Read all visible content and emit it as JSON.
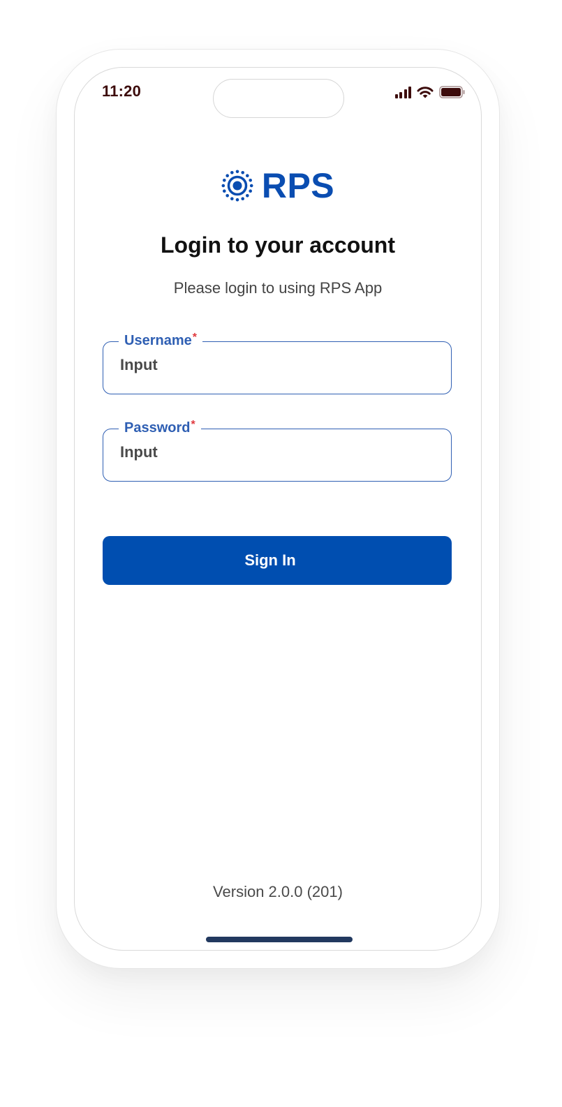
{
  "status_bar": {
    "time": "11:20",
    "signal_icon": "cellular-signal-icon",
    "wifi_icon": "wifi-icon",
    "battery_icon": "battery-icon"
  },
  "brand": {
    "logo_icon": "sun-dots-icon",
    "name": "RPS",
    "color": "#0a4db1"
  },
  "login": {
    "title": "Login to your account",
    "subtitle": "Please login to using RPS App",
    "username": {
      "label": "Username",
      "required_mark": "*",
      "value": "Input"
    },
    "password": {
      "label": "Password",
      "required_mark": "*",
      "value": "Input"
    },
    "sign_in_label": "Sign In",
    "accent_color": "#004eb0"
  },
  "footer": {
    "version": "Version 2.0.0 (201)"
  }
}
